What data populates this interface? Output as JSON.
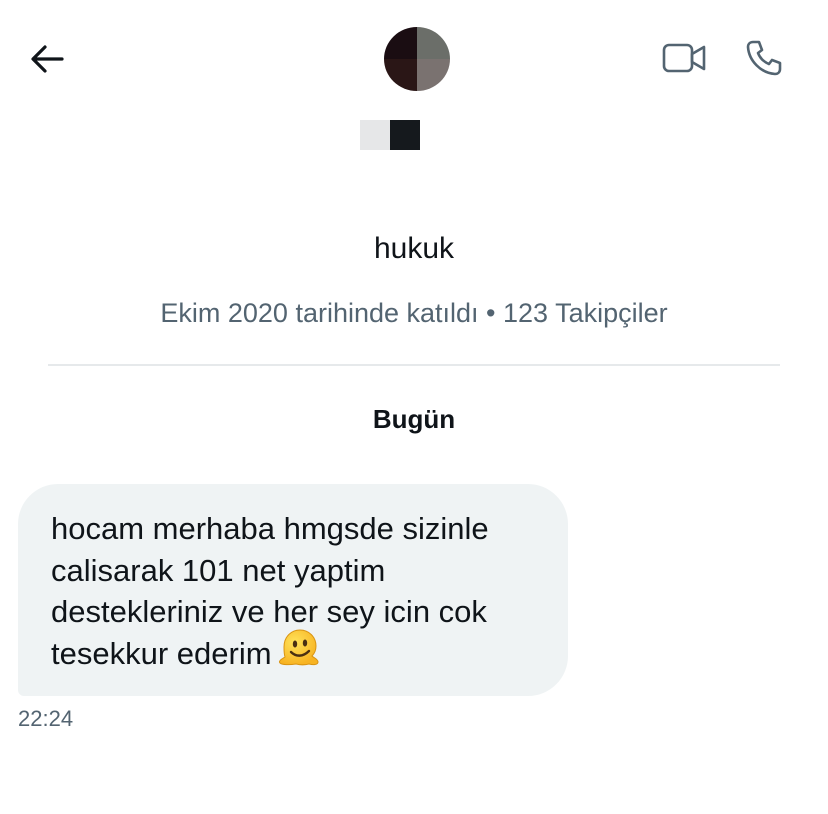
{
  "header": {
    "back_icon": "arrow-left-icon",
    "video_icon": "video-camera-icon",
    "phone_icon": "phone-icon"
  },
  "profile": {
    "handle": "hukuk",
    "meta": "Ekim 2020 tarihinde katıldı • 123 Takipçiler"
  },
  "conversation": {
    "day_label": "Bugün",
    "messages": [
      {
        "text": "hocam merhaba hmgsde sizinle calisarak 101 net yaptim destekleriniz ve her sey icin cok tesekkur ederim",
        "emoji": "melting-face-icon",
        "time": "22:24"
      }
    ]
  },
  "colors": {
    "primary_text": "#0f1419",
    "secondary_text": "#536471",
    "bubble_bg": "#eff3f4",
    "divider": "#e6e9eb",
    "icon_gray": "#536471"
  }
}
